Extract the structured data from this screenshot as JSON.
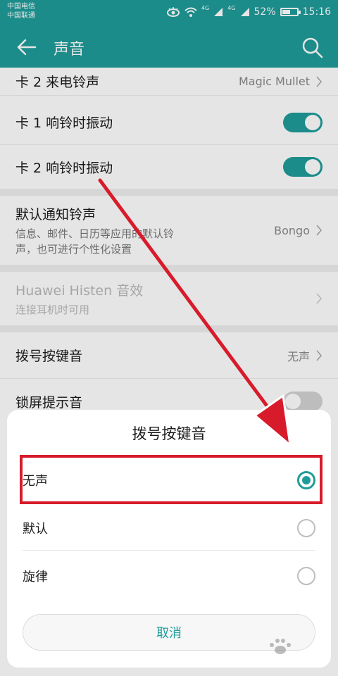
{
  "status": {
    "carrier_1": "中国电信",
    "carrier_2": "中国联通",
    "signal_1": "4G",
    "signal_2": "4G",
    "battery": "52%",
    "battery_level": 0.52,
    "time": "15:16"
  },
  "appbar": {
    "title": "声音",
    "back_icon": "arrow-left-icon",
    "search_icon": "search-icon"
  },
  "settings": {
    "card2_ringtone": {
      "label": "卡 2 来电铃声",
      "value": "Magic Mullet"
    },
    "card1_vibrate": {
      "label": "卡 1 响铃时振动",
      "on": true
    },
    "card2_vibrate": {
      "label": "卡 2 响铃时振动",
      "on": true
    },
    "notification_tone": {
      "label": "默认通知铃声",
      "desc_line1": "信息、邮件、日历等应用的默认铃",
      "desc_line2": "声，也可进行个性化设置",
      "value": "Bongo"
    },
    "histen": {
      "label": "Huawei Histen 音效",
      "desc": "连接耳机时可用"
    },
    "dial_tone": {
      "label": "拨号按键音",
      "value": "无声"
    },
    "lock_sound": {
      "label": "锁屏提示音",
      "on": false
    }
  },
  "dialog": {
    "title": "拨号按键音",
    "options": [
      {
        "label": "无声",
        "selected": true
      },
      {
        "label": "默认",
        "selected": false
      },
      {
        "label": "旋律",
        "selected": false
      }
    ],
    "cancel": "取消"
  },
  "colors": {
    "accent": "#1f9c9a",
    "annotation": "#d81b2b"
  }
}
